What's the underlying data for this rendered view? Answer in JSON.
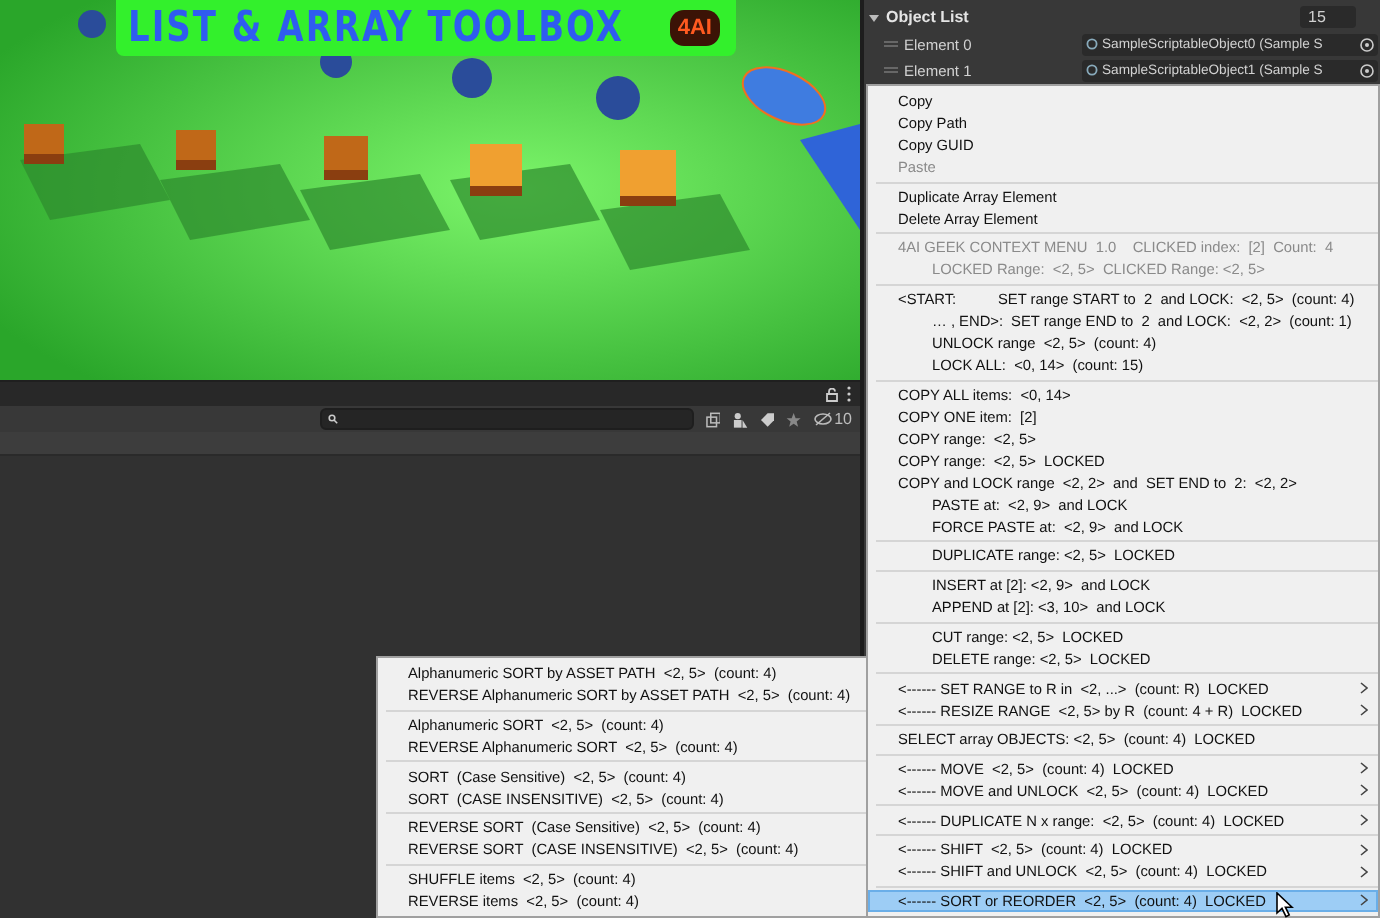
{
  "scene": {
    "banner_title": "LIST & ARRAY TOOLBOX",
    "logo": "4AI"
  },
  "scene_toolbar": {
    "hidden_count": "10"
  },
  "inspector": {
    "title": "Object List",
    "expanded": true,
    "size": "15",
    "elements": [
      {
        "label": "Element 0",
        "value": "SampleScriptableObject0 (Sample S"
      },
      {
        "label": "Element 1",
        "value": "SampleScriptableObject1 (Sample S"
      }
    ]
  },
  "context_menu": {
    "groups": [
      {
        "items": [
          {
            "label": "Copy",
            "disabled": false,
            "indented": false,
            "submenu": false,
            "selected": false
          },
          {
            "label": "Copy Path",
            "disabled": false,
            "indented": false,
            "submenu": false,
            "selected": false
          },
          {
            "label": "Copy GUID",
            "disabled": false,
            "indented": false,
            "submenu": false,
            "selected": false
          },
          {
            "label": "Paste",
            "disabled": true,
            "indented": false,
            "submenu": false,
            "selected": false
          }
        ]
      },
      {
        "items": [
          {
            "label": "Duplicate Array Element",
            "disabled": false,
            "indented": false,
            "submenu": false,
            "selected": false
          },
          {
            "label": "Delete Array Element",
            "disabled": false,
            "indented": false,
            "submenu": false,
            "selected": false
          }
        ]
      },
      {
        "items": [
          {
            "label": "4AI GEEK CONTEXT MENU  1.0    CLICKED index:  [2]  Count:  4",
            "disabled": true,
            "indented": false,
            "submenu": false,
            "selected": false
          },
          {
            "label": "LOCKED Range:  <2, 5>  CLICKED Range: <2, 5>",
            "disabled": true,
            "indented": true,
            "submenu": false,
            "selected": false
          }
        ]
      },
      {
        "items": [
          {
            "label": "<START:",
            "detail": "SET range START to  2  and LOCK:  <2, 5>  (count: 4)",
            "disabled": false,
            "indented": false,
            "submenu": false,
            "selected": false
          },
          {
            "label": "… , END>:",
            "detail": "SET range END to  2  and LOCK:  <2, 2>  (count: 1)",
            "disabled": false,
            "indented": true,
            "submenu": false,
            "selected": false
          },
          {
            "label": "UNLOCK range  <2, 5>  (count: 4)",
            "disabled": false,
            "indented": true,
            "submenu": false,
            "selected": false
          },
          {
            "label": "LOCK ALL:  <0, 14>  (count: 15)",
            "disabled": false,
            "indented": true,
            "submenu": false,
            "selected": false
          }
        ]
      },
      {
        "items": [
          {
            "label": "COPY ALL items:  <0, 14>",
            "disabled": false,
            "indented": false,
            "submenu": false,
            "selected": false
          },
          {
            "label": "COPY ONE item:  [2]",
            "disabled": false,
            "indented": false,
            "submenu": false,
            "selected": false
          },
          {
            "label": "COPY range:  <2, 5>",
            "disabled": false,
            "indented": false,
            "submenu": false,
            "selected": false
          },
          {
            "label": "COPY range:  <2, 5>  LOCKED",
            "disabled": false,
            "indented": false,
            "submenu": false,
            "selected": false
          },
          {
            "label": "COPY and LOCK range  <2, 2>  and  SET END to  2:  <2, 2>",
            "disabled": false,
            "indented": false,
            "submenu": false,
            "selected": false
          },
          {
            "label": "PASTE at:  <2, 9>  and LOCK",
            "disabled": false,
            "indented": true,
            "submenu": false,
            "selected": false
          },
          {
            "label": "FORCE PASTE at:  <2, 9>  and LOCK",
            "disabled": false,
            "indented": true,
            "submenu": false,
            "selected": false
          }
        ]
      },
      {
        "items": [
          {
            "label": "DUPLICATE range: <2, 5>  LOCKED",
            "disabled": false,
            "indented": true,
            "submenu": false,
            "selected": false
          }
        ]
      },
      {
        "items": [
          {
            "label": "INSERT at [2]: <2, 9>  and LOCK",
            "disabled": false,
            "indented": true,
            "submenu": false,
            "selected": false
          },
          {
            "label": "APPEND at [2]: <3, 10>  and LOCK",
            "disabled": false,
            "indented": true,
            "submenu": false,
            "selected": false
          }
        ]
      },
      {
        "items": [
          {
            "label": "CUT range: <2, 5>  LOCKED",
            "disabled": false,
            "indented": true,
            "submenu": false,
            "selected": false
          },
          {
            "label": "DELETE range: <2, 5>  LOCKED",
            "disabled": false,
            "indented": true,
            "submenu": false,
            "selected": false
          }
        ]
      },
      {
        "items": [
          {
            "label": "<------ SET RANGE to R in  <2, ...>  (count: R)  LOCKED",
            "disabled": false,
            "indented": false,
            "submenu": true,
            "selected": false
          },
          {
            "label": "<------ RESIZE RANGE  <2, 5> by R  (count: 4 + R)  LOCKED",
            "disabled": false,
            "indented": false,
            "submenu": true,
            "selected": false
          }
        ]
      },
      {
        "items": [
          {
            "label": "SELECT array OBJECTS: <2, 5>  (count: 4)  LOCKED",
            "disabled": false,
            "indented": false,
            "submenu": false,
            "selected": false
          }
        ]
      },
      {
        "items": [
          {
            "label": "<------ MOVE  <2, 5>  (count: 4)  LOCKED",
            "disabled": false,
            "indented": false,
            "submenu": true,
            "selected": false
          },
          {
            "label": "<------ MOVE and UNLOCK  <2, 5>  (count: 4)  LOCKED",
            "disabled": false,
            "indented": false,
            "submenu": true,
            "selected": false
          }
        ]
      },
      {
        "items": [
          {
            "label": "<------ DUPLICATE N x range:  <2, 5>  (count: 4)  LOCKED",
            "disabled": false,
            "indented": false,
            "submenu": true,
            "selected": false
          }
        ]
      },
      {
        "items": [
          {
            "label": "<------ SHIFT  <2, 5>  (count: 4)  LOCKED",
            "disabled": false,
            "indented": false,
            "submenu": true,
            "selected": false
          },
          {
            "label": "<------ SHIFT and UNLOCK  <2, 5>  (count: 4)  LOCKED",
            "disabled": false,
            "indented": false,
            "submenu": true,
            "selected": false
          }
        ]
      },
      {
        "items": [
          {
            "label": "<------ SORT or REORDER  <2, 5>  (count: 4)  LOCKED",
            "disabled": false,
            "indented": false,
            "submenu": true,
            "selected": true
          }
        ]
      }
    ]
  },
  "submenu": {
    "groups": [
      {
        "items": [
          "Alphanumeric SORT by ASSET PATH  <2, 5>  (count: 4)",
          "REVERSE Alphanumeric SORT by ASSET PATH  <2, 5>  (count: 4)"
        ]
      },
      {
        "items": [
          "Alphanumeric SORT  <2, 5>  (count: 4)",
          "REVERSE Alphanumeric SORT  <2, 5>  (count: 4)"
        ]
      },
      {
        "items": [
          "SORT  (Case Sensitive)  <2, 5>  (count: 4)",
          "SORT  (CASE INSENSITIVE)  <2, 5>  (count: 4)"
        ]
      },
      {
        "items": [
          "REVERSE SORT  (Case Sensitive)  <2, 5>  (count: 4)",
          "REVERSE SORT  (CASE INSENSITIVE)  <2, 5>  (count: 4)"
        ]
      },
      {
        "items": [
          "SHUFFLE items  <2, 5>  (count: 4)",
          "REVERSE items  <2, 5>  (count: 4)"
        ]
      }
    ]
  }
}
